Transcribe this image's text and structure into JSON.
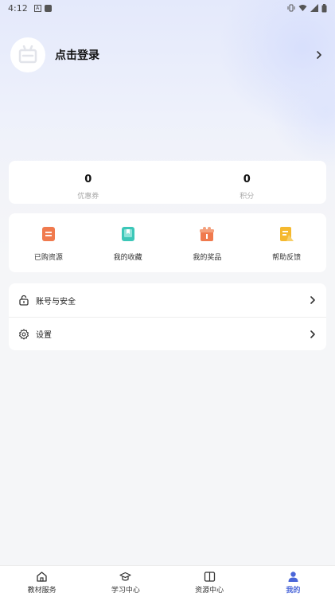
{
  "status_bar": {
    "time": "4:12"
  },
  "profile": {
    "login_label": "点击登录"
  },
  "stats": [
    {
      "value": "0",
      "label": "优惠券"
    },
    {
      "value": "0",
      "label": "积分"
    }
  ],
  "grid": [
    {
      "label": "已购资源",
      "icon": "purchased-icon",
      "color": "#f07a4e"
    },
    {
      "label": "我的收藏",
      "icon": "favorites-icon",
      "color": "#3cc7b8"
    },
    {
      "label": "我的奖品",
      "icon": "prize-icon",
      "color": "#f07a4e"
    },
    {
      "label": "帮助反馈",
      "icon": "help-icon",
      "color": "#f5b92f"
    }
  ],
  "menu": [
    {
      "label": "账号与安全",
      "icon": "lock-icon"
    },
    {
      "label": "设置",
      "icon": "gear-icon"
    }
  ],
  "tabbar": [
    {
      "label": "教材服务",
      "icon": "home-icon",
      "active": false
    },
    {
      "label": "学习中心",
      "icon": "graduation-cap-icon",
      "active": false
    },
    {
      "label": "资源中心",
      "icon": "book-icon",
      "active": false
    },
    {
      "label": "我的",
      "icon": "user-icon",
      "active": true
    }
  ],
  "colors": {
    "accent": "#4a66d8",
    "background": "#f5f6f8"
  }
}
